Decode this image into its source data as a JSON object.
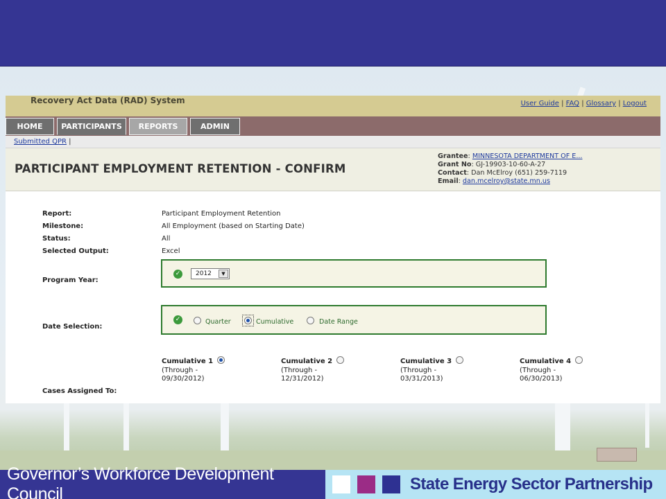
{
  "app": {
    "title": "Recovery Act Data (RAD) System",
    "links": [
      "User Guide",
      "FAQ",
      "Glossary",
      "Logout"
    ]
  },
  "nav": {
    "tabs": [
      "HOME",
      "PARTICIPANTS",
      "REPORTS",
      "ADMIN"
    ],
    "active": "PARTICIPANTS"
  },
  "breadcrumb": {
    "link": "Submitted QPR",
    "separator": "|"
  },
  "page": {
    "title": "PARTICIPANT EMPLOYMENT RETENTION - CONFIRM"
  },
  "grantee": {
    "grantee_label": "Grantee",
    "grantee_value": "MINNESOTA DEPARTMENT OF E...",
    "grant_label": "Grant No",
    "grant_value": "GJ-19903-10-60-A-27",
    "contact_label": "Contact",
    "contact_value": "Dan McElroy (651) 259-7119",
    "email_label": "Email",
    "email_value": "dan.mcelroy@state.mn.us"
  },
  "form": {
    "report_label": "Report:",
    "report_value": "Participant Employment Retention",
    "milestone_label": "Milestone:",
    "milestone_value": "All Employment (based on Starting Date)",
    "status_label": "Status:",
    "status_value": "All",
    "output_label": "Selected Output:",
    "output_value": "Excel",
    "program_year_label": "Program Year:",
    "program_year_value": "2012",
    "date_selection_label": "Date Selection:",
    "date_options": [
      {
        "label": "Quarter",
        "selected": false
      },
      {
        "label": "Cumulative",
        "selected": true
      },
      {
        "label": "Date Range",
        "selected": false
      }
    ],
    "cumulatives": [
      {
        "title": "Cumulative 1",
        "line1": "(Through -",
        "line2": "09/30/2012)",
        "selected": true
      },
      {
        "title": "Cumulative 2",
        "line1": "(Through -",
        "line2": "12/31/2012)",
        "selected": false
      },
      {
        "title": "Cumulative 3",
        "line1": "(Through -",
        "line2": "03/31/2013)",
        "selected": false
      },
      {
        "title": "Cumulative 4",
        "line1": "(Through -",
        "line2": "06/30/2013)",
        "selected": false
      }
    ],
    "cases_label": "Cases Assigned To:"
  },
  "footer": {
    "left": "Governor’s Workforce Development Council",
    "right": "State Energy Sector Partnership",
    "square_colors": [
      "#ffffff",
      "#9b2c86",
      "#2e3192"
    ]
  }
}
